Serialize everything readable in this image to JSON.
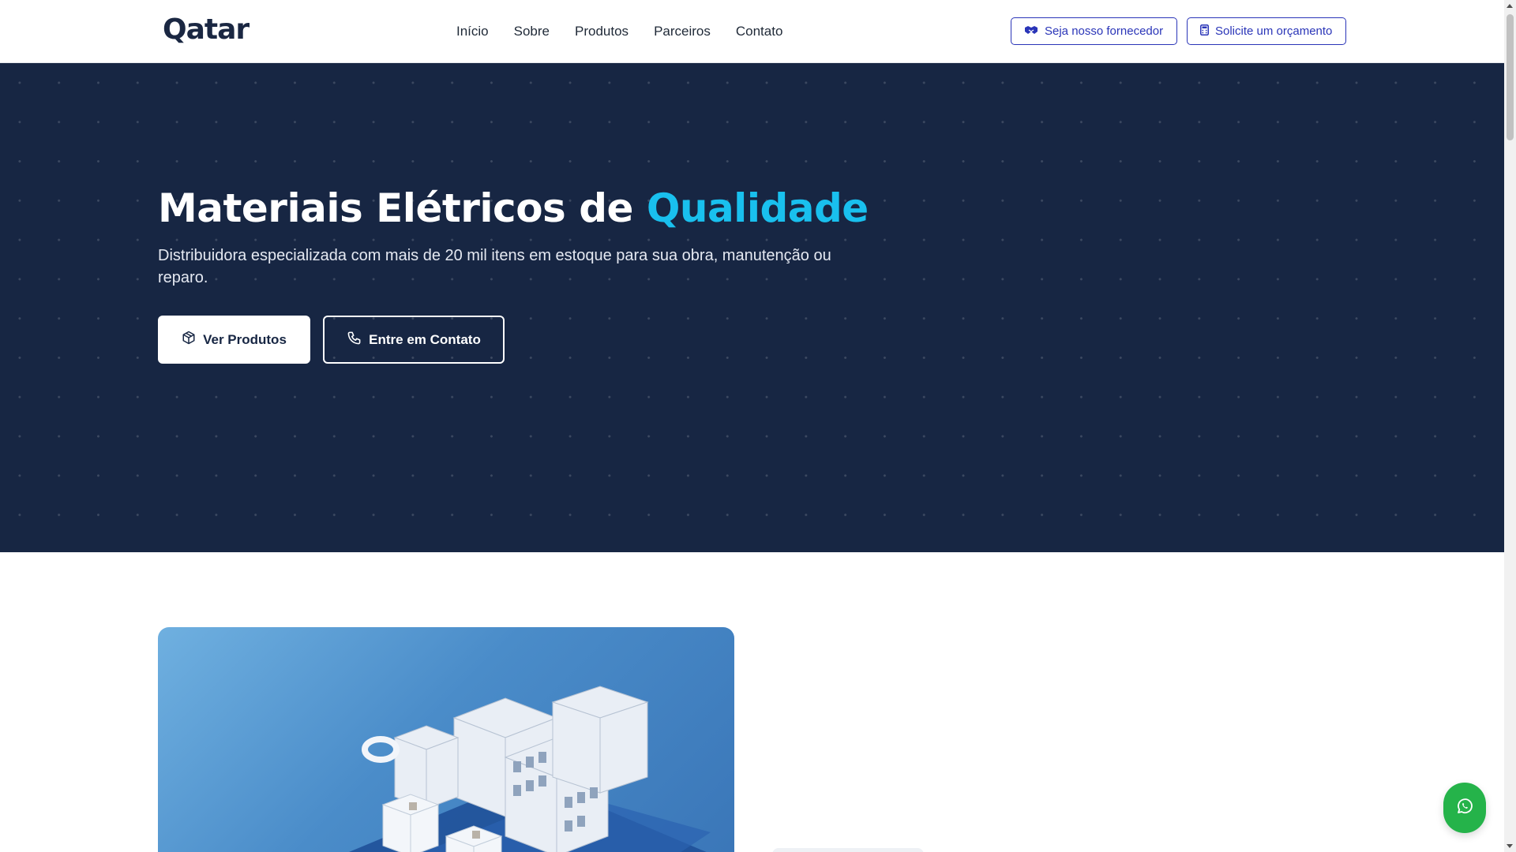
{
  "header": {
    "logo_text": "Qatar",
    "nav": [
      "Início",
      "Sobre",
      "Produtos",
      "Parceiros",
      "Contato"
    ],
    "supplier_button": "Seja nosso fornecedor",
    "quote_button": "Solicite um orçamento"
  },
  "hero": {
    "title_main": "Materiais Elétricos de",
    "title_accent": "Qualidade",
    "subtitle": "Distribuidora especializada com mais de 20 mil itens em estoque para sua obra, manutenção ou reparo.",
    "primary_button": "Ver Produtos",
    "secondary_button": "Entre em Contato"
  },
  "colors": {
    "hero_bg": "#172643",
    "accent": "#19c0ee",
    "brand_blue": "#2a35b8",
    "whatsapp": "#25b34a"
  },
  "icons": {
    "supplier": "handshake-icon",
    "quote": "calculator-icon",
    "products": "package-icon",
    "contact": "phone-icon",
    "float": "whatsapp-icon"
  }
}
